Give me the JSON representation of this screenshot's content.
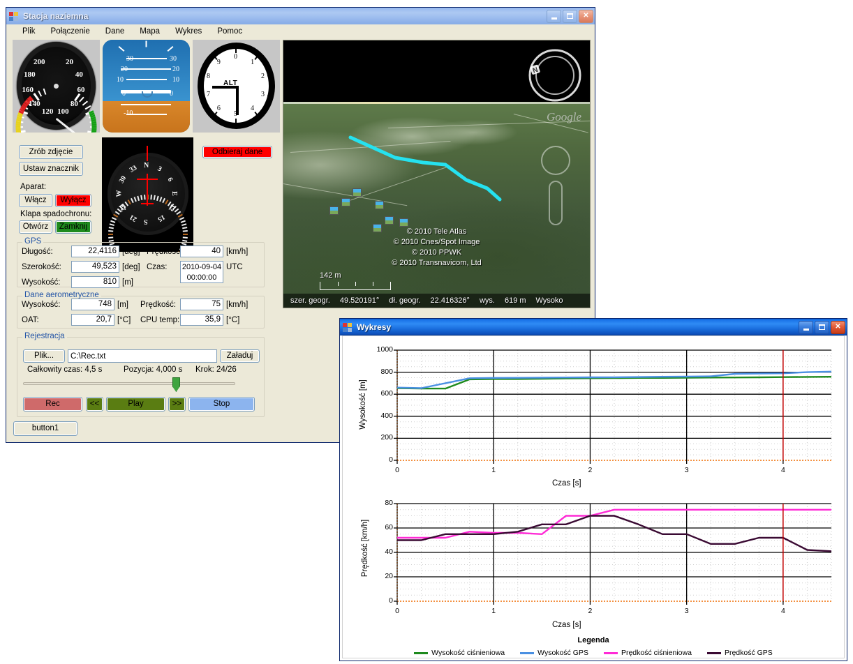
{
  "main_window": {
    "title": "Stacja naziemna",
    "icon": "app-icon",
    "window_buttons": {
      "minimize": "minimize-icon",
      "maximize": "maximize-icon",
      "close": "close-icon"
    },
    "menu": [
      "Plik",
      "Połączenie",
      "Dane",
      "Mapa",
      "Wykres",
      "Pomoc"
    ],
    "instruments": {
      "airspeed": {
        "name": "airspeed-indicator",
        "labels": [
          "20",
          "40",
          "60",
          "80",
          "100",
          "120",
          "140",
          "160",
          "180",
          "200"
        ],
        "needle_value": 78
      },
      "attitude": {
        "name": "attitude-indicator",
        "labels": [
          "30",
          "20",
          "10",
          "0",
          "-10",
          "30",
          "20",
          "10",
          "0"
        ]
      },
      "altimeter": {
        "name": "altimeter",
        "labels": [
          "0",
          "1",
          "2",
          "3",
          "4",
          "5",
          "6",
          "7",
          "8",
          "9"
        ],
        "center_text": "ALT"
      },
      "compass": {
        "name": "compass",
        "labels": [
          "N",
          "3",
          "6",
          "E",
          "12",
          "15",
          "S",
          "21",
          "24",
          "W",
          "30",
          "33"
        ]
      }
    },
    "buttons": {
      "take_photo": "Zrób zdjęcie",
      "set_marker": "Ustaw znacznik",
      "receive_data": "Odbieraj dane",
      "extra": "button1"
    },
    "camera": {
      "label": "Aparat:",
      "on": "Włącz",
      "off": "Wyłącz"
    },
    "parachute": {
      "label": "Klapa spadochronu:",
      "open": "Otwórz",
      "close": "Zamknij"
    },
    "gps": {
      "caption": "GPS",
      "longitude_label": "Długość:",
      "longitude_value": "22,4116",
      "longitude_unit": "[deg]",
      "latitude_label": "Szerokość:",
      "latitude_value": "49,523",
      "latitude_unit": "[deg]",
      "altitude_label": "Wysokość:",
      "altitude_value": "810",
      "altitude_unit": "[m]",
      "speed_label": "Prędkość:",
      "speed_value": "40",
      "speed_unit": "[km/h]",
      "time_label": "Czas:",
      "time_value": "2010-09-04 00:00:00",
      "time_unit": "UTC"
    },
    "aero": {
      "caption": "Dane aerometryczne",
      "altitude_label": "Wysokość:",
      "altitude_value": "748",
      "altitude_unit": "[m]",
      "speed_label": "Prędkość:",
      "speed_value": "75",
      "speed_unit": "[km/h]",
      "oat_label": "OAT:",
      "oat_value": "20,7",
      "oat_unit": "[°C]",
      "cpu_label": "CPU temp:",
      "cpu_value": "35,9",
      "cpu_unit": "[°C]"
    },
    "recording": {
      "caption": "Rejestracja",
      "file_button": "Plik...",
      "file_path": "C:\\Rec.txt",
      "load_button": "Załaduj",
      "total_time": "Całkowity czas: 4,5 s",
      "position": "Pozycja: 4,000 s",
      "step": "Krok: 24/26",
      "slider_percent": 73,
      "rec": "Rec",
      "prev": "<<",
      "play": "Play",
      "next": ">>",
      "stop": "Stop"
    },
    "map_view": {
      "attribution": [
        "© 2010 Tele Atlas",
        "© 2010 Cnes/Spot Image",
        "© 2010 PPWK",
        "© 2010 Transnavicom, Ltd"
      ],
      "scale": "142 m",
      "brand": "Google",
      "status": {
        "lat_label": "szer. geogr.",
        "lat_value": "49.520191°",
        "lon_label": "dł. geogr.",
        "lon_value": "22.416326°",
        "elev_label": "wys.",
        "elev_value": "619 m",
        "eye_label": "Wysoko"
      },
      "track_color": "#25E2F0",
      "nav_icon": "navigation-compass-icon"
    }
  },
  "charts_window": {
    "title": "Wykresy",
    "icon": "app-icon",
    "window_buttons": {
      "minimize": "minimize-icon",
      "maximize": "maximize-icon",
      "close": "close-icon"
    },
    "legend_title": "Legenda"
  },
  "chart_data": [
    {
      "type": "line",
      "name": "altitude-chart",
      "title": "",
      "xlabel": "Czas [s]",
      "ylabel": "Wysokość [m]",
      "xlim": [
        0,
        4.5
      ],
      "ylim": [
        0,
        1000
      ],
      "xticks": [
        0,
        1,
        2,
        3,
        4
      ],
      "yticks": [
        0,
        200,
        400,
        600,
        800,
        1000
      ],
      "grid": true,
      "cursor_x": 4.0,
      "cursor_color": "#d00000",
      "x": [
        0,
        0.25,
        0.5,
        0.75,
        1,
        1.25,
        1.5,
        1.75,
        2,
        2.25,
        2.5,
        2.75,
        3,
        3.25,
        3.5,
        3.75,
        4,
        4.25,
        4.5
      ],
      "series": [
        {
          "name": "Wysokość ciśnieniowa",
          "color": "#1E8A1E",
          "values": [
            655,
            651,
            651,
            735,
            738,
            738,
            740,
            743,
            745,
            746,
            748,
            748,
            750,
            751,
            752,
            753,
            755,
            757,
            758
          ]
        },
        {
          "name": "Wysokość GPS",
          "color": "#4A90E2",
          "values": [
            660,
            655,
            700,
            745,
            748,
            749,
            750,
            752,
            753,
            754,
            756,
            758,
            760,
            762,
            785,
            788,
            790,
            800,
            805
          ]
        }
      ]
    },
    {
      "type": "line",
      "name": "speed-chart",
      "title": "",
      "xlabel": "Czas [s]",
      "ylabel": "Prędkość [km/h]",
      "xlim": [
        0,
        4.5
      ],
      "ylim": [
        0,
        80
      ],
      "xticks": [
        0,
        1,
        2,
        3,
        4
      ],
      "yticks": [
        0,
        20,
        40,
        60,
        80
      ],
      "grid": true,
      "cursor_x": 4.0,
      "cursor_color": "#d00000",
      "x": [
        0,
        0.25,
        0.5,
        0.75,
        1,
        1.25,
        1.5,
        1.75,
        2,
        2.25,
        2.5,
        2.75,
        3,
        3.25,
        3.5,
        3.75,
        4,
        4.25,
        4.5
      ],
      "series": [
        {
          "name": "Prędkość ciśnieniowa",
          "color": "#FF2BD6",
          "values": [
            52,
            52,
            52,
            57,
            56,
            56,
            55,
            70,
            70,
            75,
            75,
            75,
            75,
            75,
            75,
            75,
            75,
            75,
            75
          ]
        },
        {
          "name": "Prędkość GPS",
          "color": "#3A0A33",
          "values": [
            50,
            50,
            55,
            55,
            55,
            57,
            63,
            63,
            70,
            70,
            63,
            55,
            55,
            47,
            47,
            52,
            52,
            42,
            41
          ]
        }
      ]
    }
  ]
}
